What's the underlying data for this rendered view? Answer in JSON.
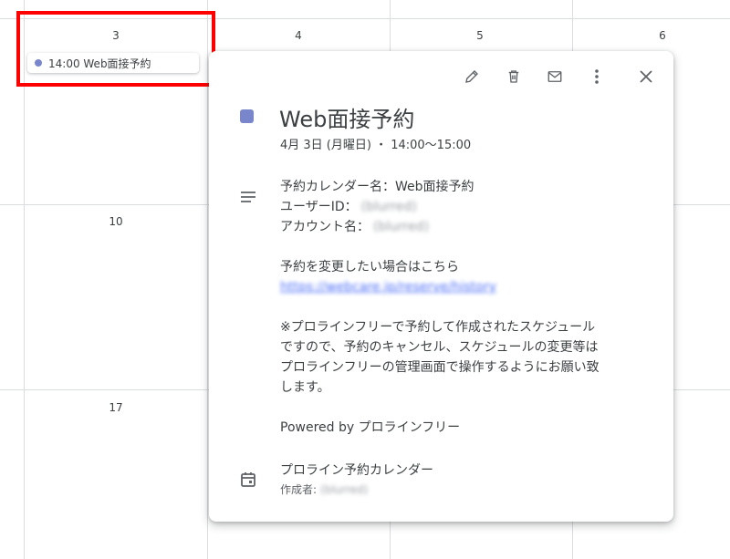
{
  "calendar": {
    "day_numbers": [
      "3",
      "4",
      "5",
      "6",
      "10",
      "17"
    ]
  },
  "event_chip": {
    "label": "14:00 Web面接予約",
    "color": "#7986cb"
  },
  "highlight_color": "#ff0000",
  "popup": {
    "toolbar": [
      "edit-icon",
      "delete-icon",
      "email-icon",
      "more-options-icon",
      "close-icon"
    ],
    "title": "Web面接予約",
    "datetime": "4月 3日 (月曜日) ・ 14:00～15:00",
    "description": {
      "calendar_name": "予約カレンダー名：Web面接予約",
      "user_id_label": "ユーザーID：",
      "user_id_value": "(blurred)",
      "account_label": "アカウント名：",
      "account_value": "(blurred)",
      "change_text": "予約を変更したい場合はこちら",
      "change_link": "https://webcare.jp/reserve/history",
      "notice_lines": [
        "※プロラインフリーで予約して作成されたスケジュール",
        "ですので、予約のキャンセル、スケジュールの変更等は",
        "プロラインフリーの管理画面で操作するようにお願い致",
        "します。"
      ],
      "powered_by": "Powered by プロラインフリー"
    },
    "calendar_owner": "プロライン予約カレンダー",
    "creator_label": "作成者:",
    "creator_value": "(blurred)"
  }
}
